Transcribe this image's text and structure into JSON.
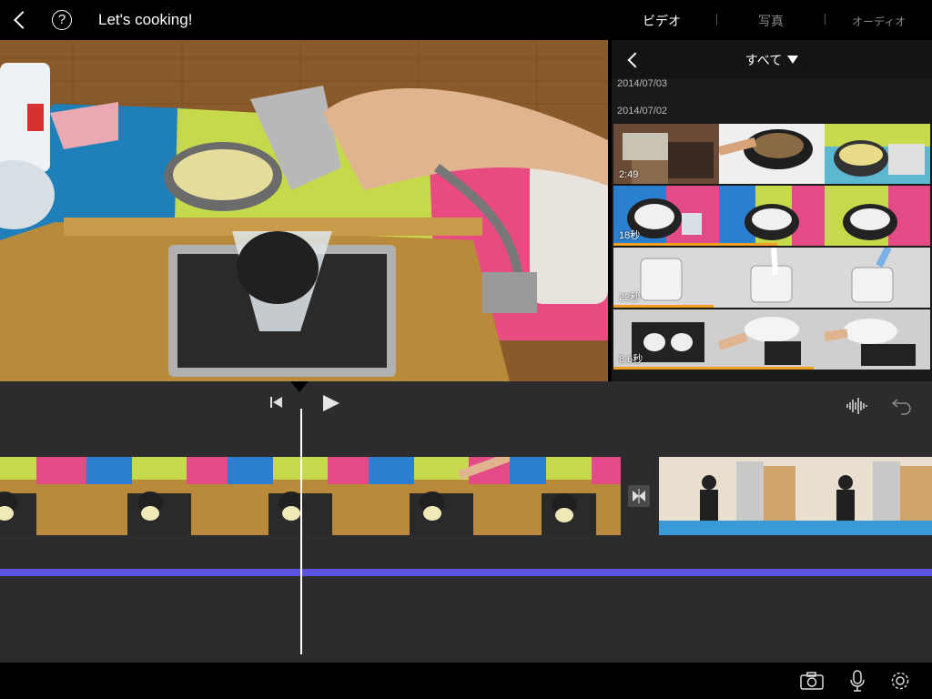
{
  "topbar": {
    "title": "Let's cooking!",
    "help_label": "?",
    "media_tabs": [
      {
        "label": "ビデオ",
        "active": true
      },
      {
        "label": "写真",
        "active": false
      },
      {
        "label": "オーディオ",
        "active": false
      }
    ]
  },
  "browser": {
    "filter_label": "すべて",
    "dates": [
      "2014/07/03",
      "2014/07/02"
    ],
    "rows": [
      {
        "duration": "2:49",
        "used_fraction": 0.0
      },
      {
        "duration": "18秒",
        "used_fraction": 0.58
      },
      {
        "duration": "22秒",
        "used_fraction": 0.32
      },
      {
        "duration": "8.6秒",
        "used_fraction": 0.52
      }
    ]
  },
  "timeline": {
    "controls": [
      "skip-to-start-icon",
      "play-icon",
      "audio-waveform-icon",
      "undo-icon"
    ],
    "transition_icon": "transition-icon"
  },
  "bottombar": {
    "icons": [
      "camera-icon",
      "microphone-icon",
      "settings-gear-icon"
    ]
  },
  "colors": {
    "accent_audio": "#5a52e0",
    "used_marker": "#f0a020",
    "timeline_bg": "#2c2c2e"
  }
}
